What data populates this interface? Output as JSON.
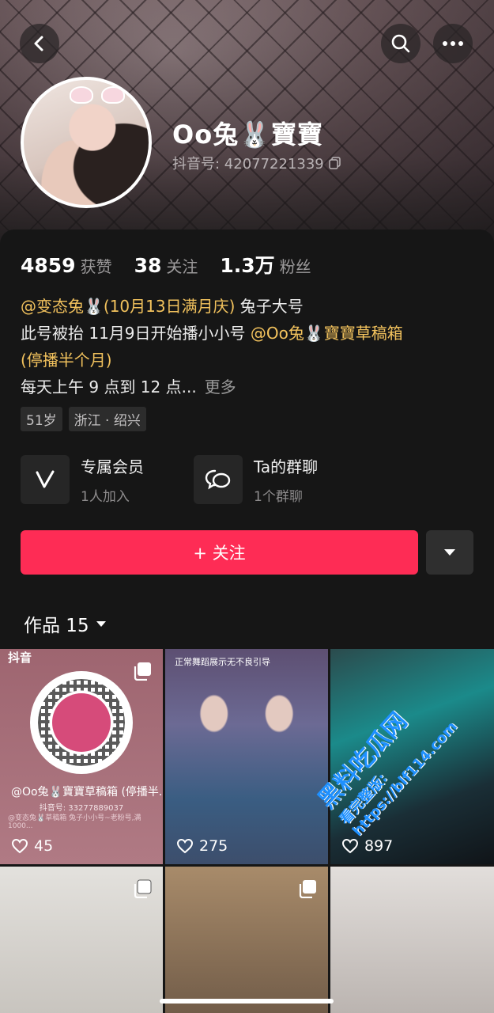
{
  "profile": {
    "name": "Oo兔🐰寶寶",
    "douyin_id": "抖音号: 42077221339"
  },
  "stats": [
    {
      "value": "4859",
      "label": "获赞"
    },
    {
      "value": "38",
      "label": "关注"
    },
    {
      "value": "1.3万",
      "label": "粉丝"
    }
  ],
  "bio": {
    "line1_mention": "@变态兔🐰(10月13日满月庆)",
    "line1_text": " 兔子大号",
    "line2_text": "此号被抬 11月9日开始播小小号 ",
    "line2_mention": "@Oo兔🐰寶寶草稿箱",
    "line3_mention": "(停播半个月)",
    "line4_text": "每天上午 9 点到 12 点...",
    "more_label": "更多"
  },
  "tags": [
    "51岁",
    "浙江 · 绍兴"
  ],
  "features": [
    {
      "title": "专属会员",
      "sub": "1人加入"
    },
    {
      "title": "Ta的群聊",
      "sub": "1个群聊"
    }
  ],
  "follow_label": "+ 关注",
  "works_tab": "作品 15",
  "grid": [
    {
      "likes": "45",
      "logo": "抖音",
      "qr_name": "@Oo兔🐰寶寶草稿箱 (停播半...",
      "qr_id": "抖音号: 33277889037",
      "qr_desc": "@变态兔🐰草稿箱 兔子小小号~老粉号,满1000..."
    },
    {
      "likes": "275",
      "caption": "正常舞蹈展示无不良引导"
    },
    {
      "likes": "897"
    }
  ],
  "watermark": {
    "line1": "黑料吃瓜网",
    "line2": "看完整版: https://blf114.com"
  },
  "colors": {
    "accent": "#fe2c55",
    "mention": "#f2c25d",
    "background": "#161616"
  }
}
